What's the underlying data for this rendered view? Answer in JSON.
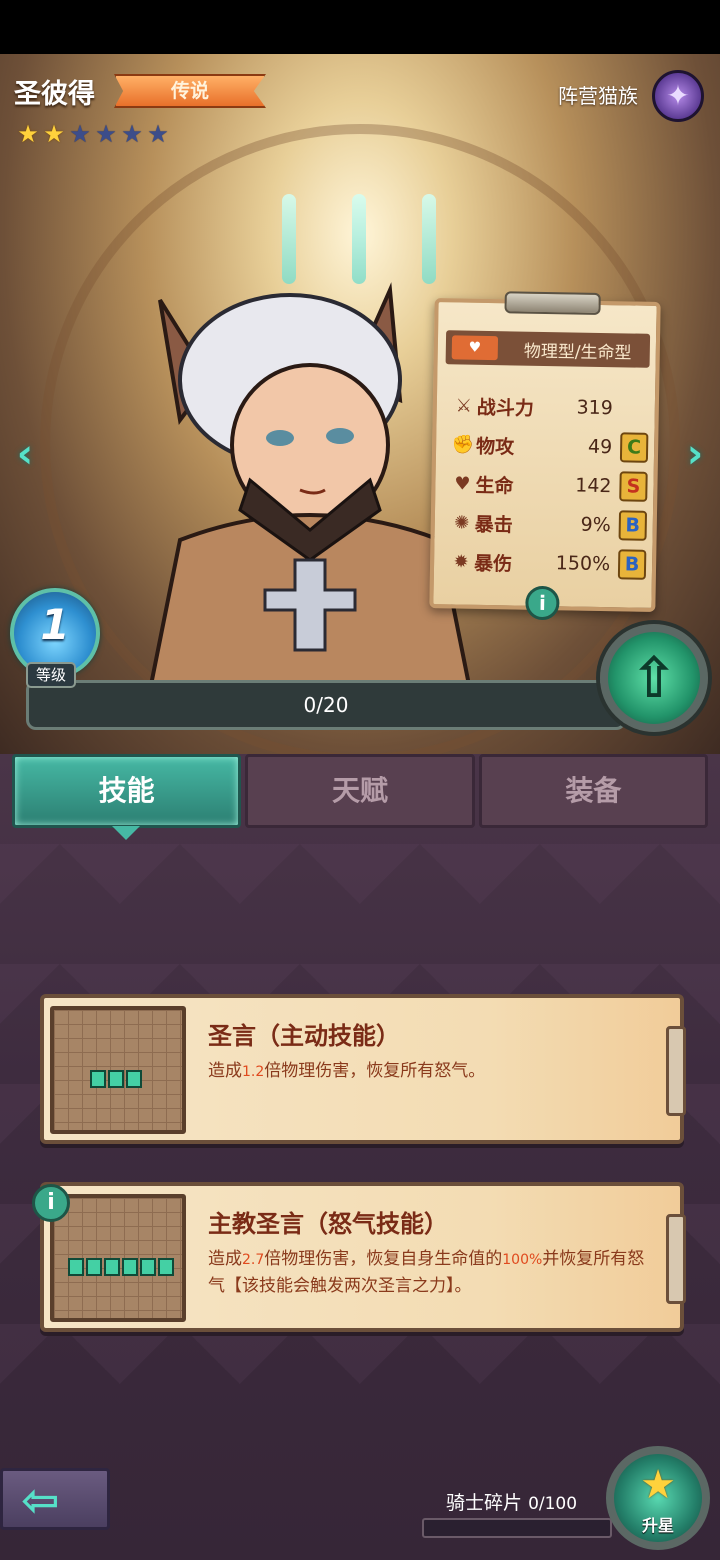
{
  "hero": {
    "name": "圣彼得",
    "rarity": "传说",
    "stars_filled": 2,
    "stars_total": 6,
    "faction_label": "阵营猫族",
    "faction_icon": "fish-bone-icon"
  },
  "stats": {
    "type": "物理型/生命型",
    "rows": [
      {
        "icon": "crossed-swords-icon",
        "label": "战斗力",
        "value": "319",
        "grade": ""
      },
      {
        "icon": "fist-icon",
        "label": "物攻",
        "value": "49",
        "grade": "C"
      },
      {
        "icon": "heart-icon",
        "label": "生命",
        "value": "142",
        "grade": "S"
      },
      {
        "icon": "crit-icon",
        "label": "暴击",
        "value": "9%",
        "grade": "B"
      },
      {
        "icon": "crit-damage-icon",
        "label": "暴伤",
        "value": "150%",
        "grade": "B"
      }
    ],
    "info_glyph": "i"
  },
  "level": {
    "number": "1",
    "label": "等级",
    "exp_text": "0/20",
    "exp_fraction": 0.0
  },
  "tabs": [
    {
      "label": "技能",
      "active": true
    },
    {
      "label": "天赋",
      "active": false
    },
    {
      "label": "装备",
      "active": false
    }
  ],
  "skills": [
    {
      "title": "圣言（主动技能）",
      "desc_pre": "造成",
      "desc_num": "1.2",
      "desc_post": "倍物理伤害，恢复所有怒气。",
      "blocks": 3
    },
    {
      "title": "主教圣言（怒气技能）",
      "desc_pre": "造成",
      "desc_num": "2.7",
      "desc_mid": "倍物理伤害，恢复自身生命值的",
      "desc_pct": "100%",
      "desc_post": "并恢复所有怒气【该技能会触发两次圣言之力】。",
      "blocks": 6
    }
  ],
  "footer": {
    "shards_label": "骑士碎片",
    "shards_count": "0/100",
    "starup_label": "升星"
  },
  "colors": {
    "accent": "#46b8a4",
    "panel": "#3e2c3f",
    "card": "#f3dcb3"
  }
}
